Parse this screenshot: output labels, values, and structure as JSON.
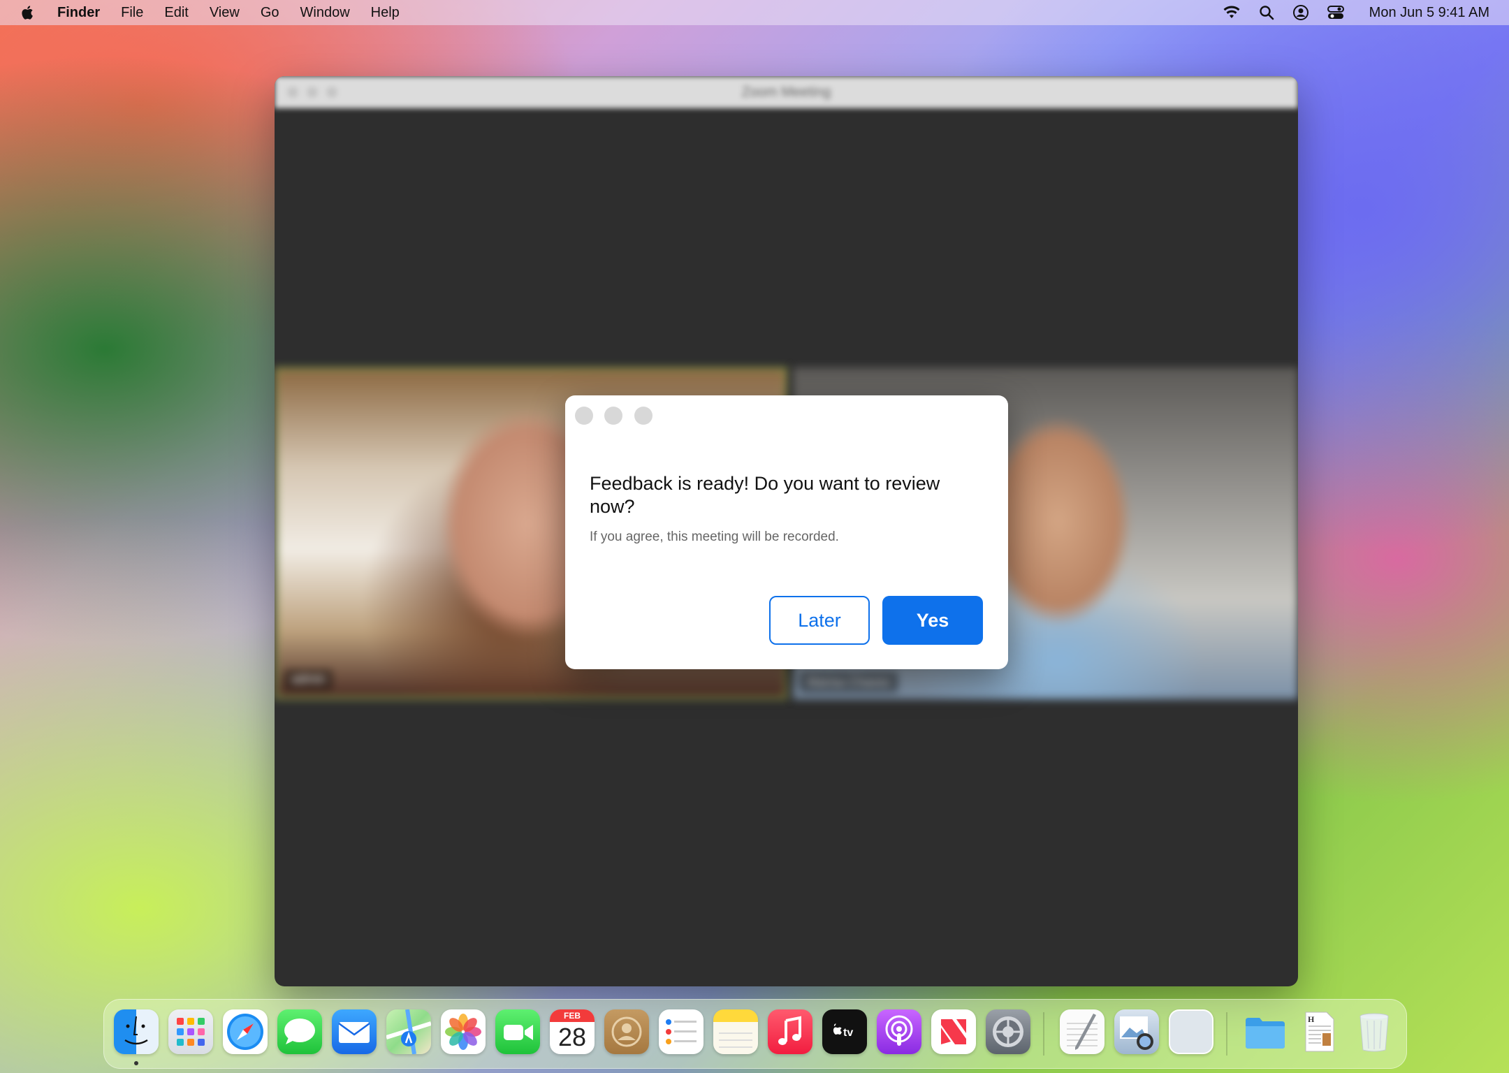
{
  "menubar": {
    "app_name": "Finder",
    "menus": [
      "File",
      "Edit",
      "View",
      "Go",
      "Window",
      "Help"
    ],
    "status_icons": [
      "wifi-icon",
      "search-icon",
      "user-icon",
      "control-center-icon"
    ],
    "clock": "Mon Jun 5  9:41 AM"
  },
  "window": {
    "title": "Zoom Meeting",
    "participants": [
      {
        "name": "admin"
      },
      {
        "name": "Marisa Chavez"
      }
    ]
  },
  "dialog": {
    "title": "Feedback is ready! Do you want to review now?",
    "subtitle": "If you agree, this meeting will be recorded.",
    "later_label": "Later",
    "yes_label": "Yes"
  },
  "calendar": {
    "month": "FEB",
    "day": "28"
  },
  "dock": {
    "apps": [
      "Finder",
      "Launchpad",
      "Safari",
      "Messages",
      "Mail",
      "Maps",
      "Photos",
      "FaceTime",
      "Calendar",
      "Contacts",
      "Reminders",
      "Notes",
      "Music",
      "TV",
      "Podcasts",
      "News",
      "System Settings",
      "TextEdit",
      "Preview",
      "Window",
      "Folder",
      "Document",
      "Trash"
    ]
  },
  "colors": {
    "accent": "#0e71eb",
    "window_bg": "#2e2e2e"
  }
}
